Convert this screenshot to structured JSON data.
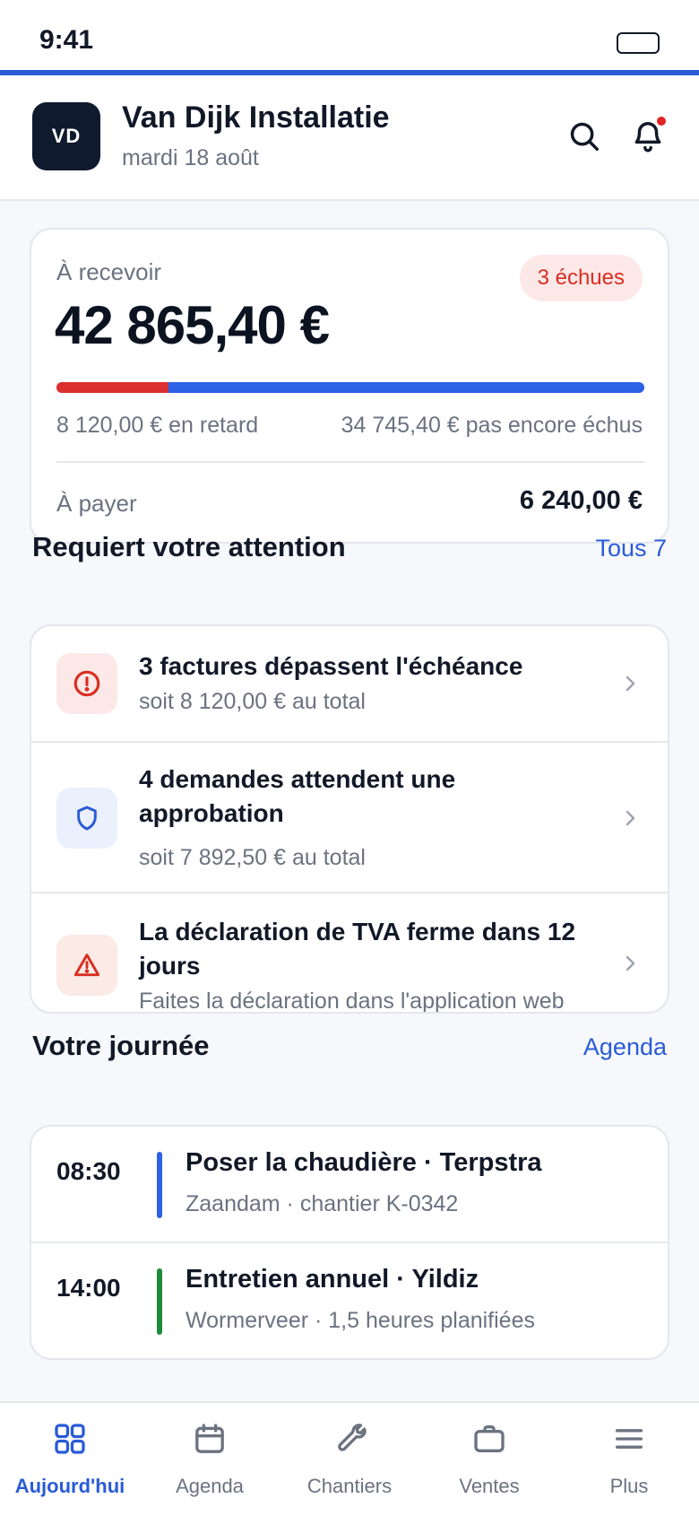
{
  "status_bar": {
    "time": "9:41"
  },
  "header": {
    "avatar_initials": "VD",
    "company": "Van Dijk Installatie",
    "date": "mardi 18 août"
  },
  "balance": {
    "receivable_label": "À recevoir",
    "receivable_amount": "42 865,40 €",
    "overdue_badge": "3 échues",
    "overdue_fraction": 0.19,
    "late_text": "8 120,00 € en retard",
    "not_due_text": "34 745,40 € pas encore échus",
    "payable_label": "À payer",
    "payable_amount": "6 240,00 €"
  },
  "attention": {
    "title": "Requiert votre attention",
    "link": "Tous 7",
    "items": [
      {
        "title": "3 factures dépassent l'échéance",
        "subtitle": "soit 8 120,00 € au total",
        "icon": "alert-circle-icon"
      },
      {
        "title": "4 demandes attendent une approbation",
        "subtitle": "soit 7 892,50 € au total",
        "icon": "shield-icon"
      },
      {
        "title": "La déclaration de TVA ferme dans 12 jours",
        "subtitle": "Faites la déclaration dans l'application web",
        "icon": "warning-triangle-icon"
      }
    ]
  },
  "day": {
    "title": "Votre journée",
    "link": "Agenda",
    "events": [
      {
        "time": "08:30",
        "title": "Poser la chaudière · Terpstra",
        "subtitle": "Zaandam · chantier K-0342",
        "color": "#2b62e6"
      },
      {
        "time": "14:00",
        "title": "Entretien annuel · Yildiz",
        "subtitle": "Wormerveer · 1,5 heures planifiées",
        "color": "#1e8a3c"
      }
    ]
  },
  "tabs": [
    {
      "label": "Aujourd'hui",
      "icon": "grid-icon",
      "active": true
    },
    {
      "label": "Agenda",
      "icon": "calendar-icon",
      "active": false
    },
    {
      "label": "Chantiers",
      "icon": "wrench-icon",
      "active": false
    },
    {
      "label": "Ventes",
      "icon": "briefcase-icon",
      "active": false
    },
    {
      "label": "Plus",
      "icon": "menu-icon",
      "active": false
    }
  ],
  "colors": {
    "accent": "#2a5bd7",
    "danger": "#dc2f2f",
    "success": "#1e8a3c"
  }
}
